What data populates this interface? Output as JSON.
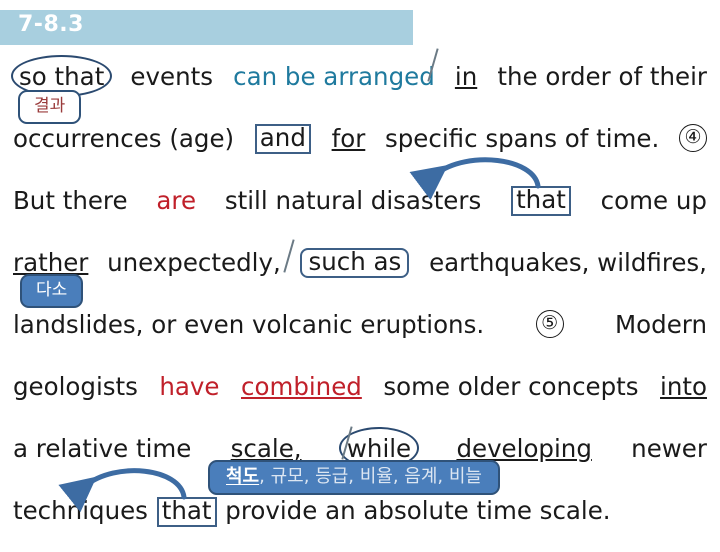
{
  "slide": {
    "title": "7-8.3",
    "title_band_color": "#a8cfdf",
    "title_text_color": "#ffffff",
    "background": "#ffffff"
  },
  "colors": {
    "red_highlight": "#c0202a",
    "teal_highlight": "#1f7a9e",
    "annotation_blue": "#2f5279",
    "chip_fill": "#4a7ebb",
    "body_text": "#1a1a1a"
  },
  "passage": {
    "line1": {
      "circled_so_that": "so that",
      "events": "events",
      "can_be_arranged": "can be arranged",
      "in_underlined": "in",
      "tail": "the order of their"
    },
    "line2": {
      "occurrences_age": "occurrences  (age)",
      "and_boxed": "and",
      "for_underlined": "for",
      "tail": "specific  spans  of  time.",
      "marker": "④"
    },
    "line3": {
      "but_there": "But  there",
      "are_red": "are",
      "still_natural_disasters": "still  natural  disasters",
      "that_boxed": "that",
      "come_up": "come  up"
    },
    "line4": {
      "rather_underlined": "rather",
      "unexpectedly": "unexpectedly,",
      "such_as_boxed": "such  as",
      "tail": "earthquakes,  wildfires,"
    },
    "line5": {
      "head": "landslides,  or  even  volcanic  eruptions.",
      "marker": "⑤",
      "tail": "Modern"
    },
    "line6": {
      "geologists": "geologists",
      "have_red": "have",
      "combined_red_underlined": "combined",
      "middle": "some  older  concepts",
      "into_underlined": "into"
    },
    "line7": {
      "head": "a    relative    time",
      "scale_underlined": "scale,",
      "while_circled": "while",
      "developing_underlined": "developing",
      "tail": "newer"
    },
    "line8": {
      "techniques": "techniques",
      "that_boxed": "that",
      "tail": "provide  an  absolute  time  scale."
    }
  },
  "glosses": {
    "gyeolgwa": "결과",
    "daso": "다소",
    "scale_meanings": {
      "highlighted": "척도",
      "rest": ", 규모, 등급, 비율, 음계, 비늘"
    }
  },
  "annotations": {
    "arrow1_name": "curved-arrow-that-to-disasters",
    "arrow2_name": "curved-arrow-that-to-techniques",
    "slash1_name": "slash-mark-before-in",
    "slash2_name": "slash-mark-before-such-as",
    "slash3_name": "slash-mark-before-while"
  }
}
